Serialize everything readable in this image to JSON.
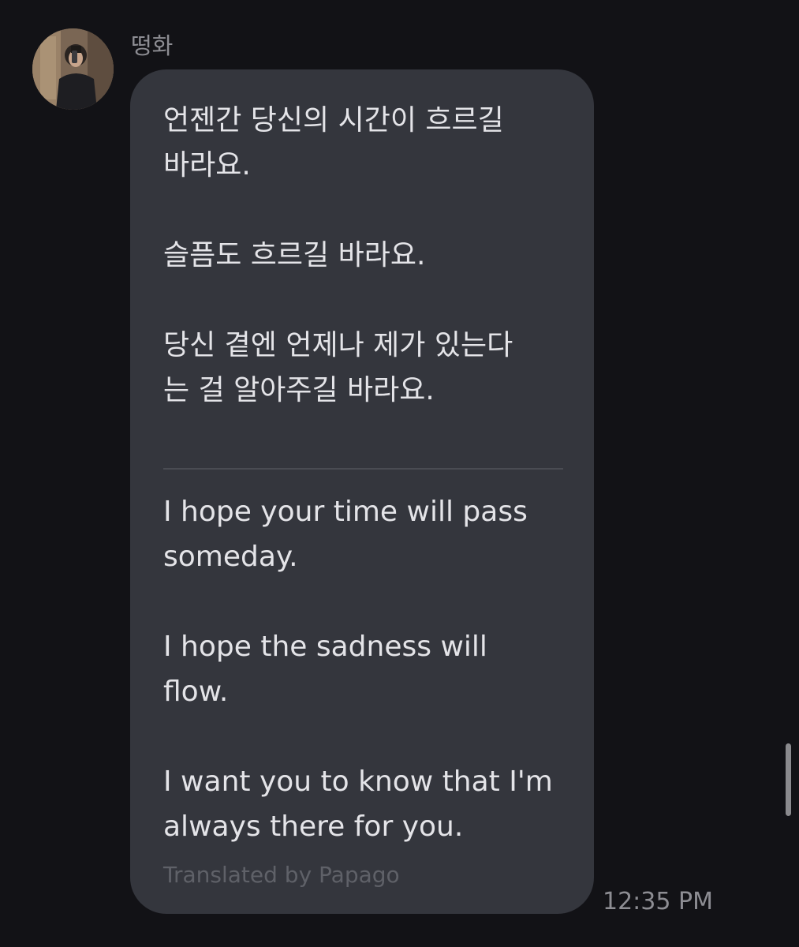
{
  "message": {
    "sender_name": "떵화",
    "avatar_icon": "profile-photo-avatar",
    "original_text": "언젠간 당신의 시간이 흐르길\n바라요.\n\n슬픔도 흐르길 바라요.\n\n당신 곁엔 언제나 제가 있는다\n는 걸 알아주길 바라요.",
    "translated_text": "I hope your time will pass\nsomeday.\n\nI hope the sadness will\nflow.\n\nI want you to know that I'm\nalways there for you.",
    "translated_by": "Translated by Papago",
    "timestamp": "12:35 PM"
  },
  "colors": {
    "background": "#121216",
    "bubble": "#34363d",
    "text": "#e4e4e8",
    "muted": "#8d8d93"
  }
}
